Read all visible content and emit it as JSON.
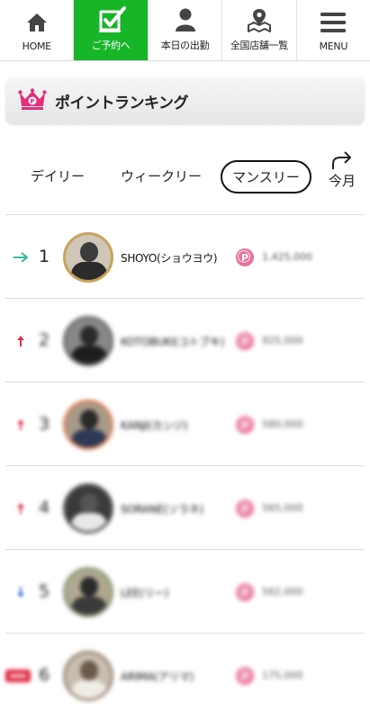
{
  "nav": [
    {
      "label": "HOME",
      "icon": "home-icon"
    },
    {
      "label": "ご予約へ",
      "icon": "reserve-check-icon",
      "active": true
    },
    {
      "label": "本日の出勤",
      "icon": "person-icon"
    },
    {
      "label": "全国店舗一覧",
      "icon": "map-pin-icon"
    },
    {
      "label": "MENU",
      "icon": "menu-icon"
    }
  ],
  "title": {
    "text": "ポイントランキング",
    "icon": "crown-p-icon"
  },
  "tabs": {
    "daily": "デイリー",
    "weekly": "ウィークリー",
    "monthly": "マンスリー",
    "selected": "monthly",
    "current_label": "今月"
  },
  "ranking": [
    {
      "rank": "1",
      "name": "SHOYO(ショウヨウ)",
      "points": "1,425,000",
      "trend": "same"
    },
    {
      "rank": "2",
      "name": "KOTOBUKI(コトブキ)",
      "points": "925,000",
      "trend": "up"
    },
    {
      "rank": "3",
      "name": "KANJI(カンジ)",
      "points": "580,000",
      "trend": "up"
    },
    {
      "rank": "4",
      "name": "SORANE(ソラネ)",
      "points": "565,000",
      "trend": "up"
    },
    {
      "rank": "5",
      "name": "LEE(リー)",
      "points": "562,000",
      "trend": "down"
    },
    {
      "rank": "6",
      "name": "ARIMA(アリマ)",
      "points": "175,000",
      "trend": "new"
    }
  ],
  "colors": {
    "accent": "#17b528",
    "point_badge": "#e8729c",
    "crown": "#e0307a"
  }
}
